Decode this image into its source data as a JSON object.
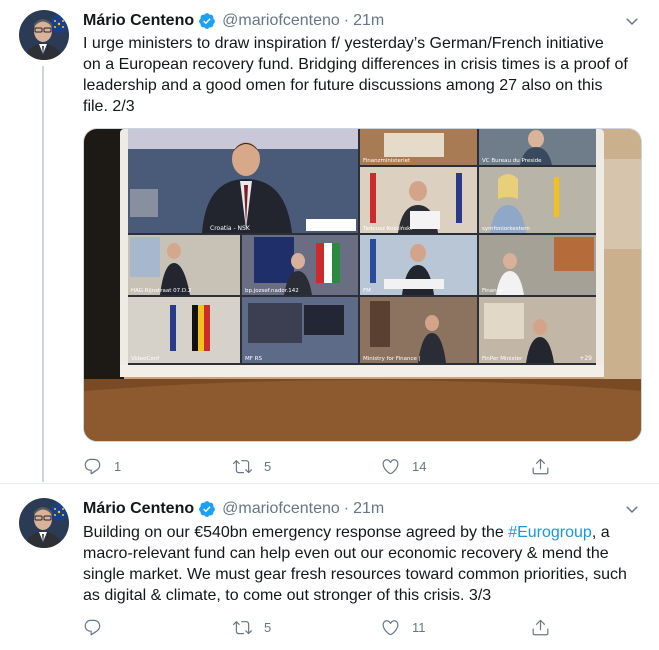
{
  "colors": {
    "accent": "#1b95e0",
    "verified": "#1da1f2",
    "secondary_text": "#657786",
    "thread_line": "#ccd6dd"
  },
  "tweets": [
    {
      "author": {
        "name": "Mário Centeno",
        "handle": "@mariofcenteno",
        "verified_icon": "verified-badge-icon",
        "avatar_icon": "avatar"
      },
      "separator": "·",
      "time": "21m",
      "text_lines": [
        "I urge ministers to draw inspiration f/ yesterday’s German/French initiative",
        "on a European recovery fund. Bridging differences in crisis times is a proof of",
        "leadership and a good omen for future discussions among 27 also on this",
        "file. 2/3"
      ],
      "media": {
        "tiles": [
          "Croatia - NSK",
          "Finanzministeriet",
          "VC Bureau du Preside",
          "Tadeusz Kościński",
          "symfoniorkestern",
          "HAG Rijnstraat 07.D.2",
          "bp.jozsef.nador.142",
          "FM",
          "Finance",
          "VideoConf",
          "MF RS",
          "Ministry for Finance |",
          "FinPer Minister"
        ],
        "overflow_count": "+29"
      },
      "actions": {
        "reply_count": "1",
        "retweet_count": "5",
        "like_count": "14"
      }
    },
    {
      "author": {
        "name": "Mário Centeno",
        "handle": "@mariofcenteno",
        "verified_icon": "verified-badge-icon",
        "avatar_icon": "avatar"
      },
      "separator": "·",
      "time": "21m",
      "text": {
        "line1_pre": "Building on our €540bn emergency response agreed by the ",
        "line1_hashtag": "#Eurogroup",
        "line1_post": ", a",
        "line2": "macro-relevant fund can help even out our economic recovery & mend the",
        "line3": "single market. We must gear fresh resources toward common priorities, such",
        "line4": "as digital & climate, to come out stronger of this crisis. 3/3"
      },
      "actions": {
        "reply_count": "",
        "retweet_count": "5",
        "like_count": "11"
      }
    }
  ]
}
